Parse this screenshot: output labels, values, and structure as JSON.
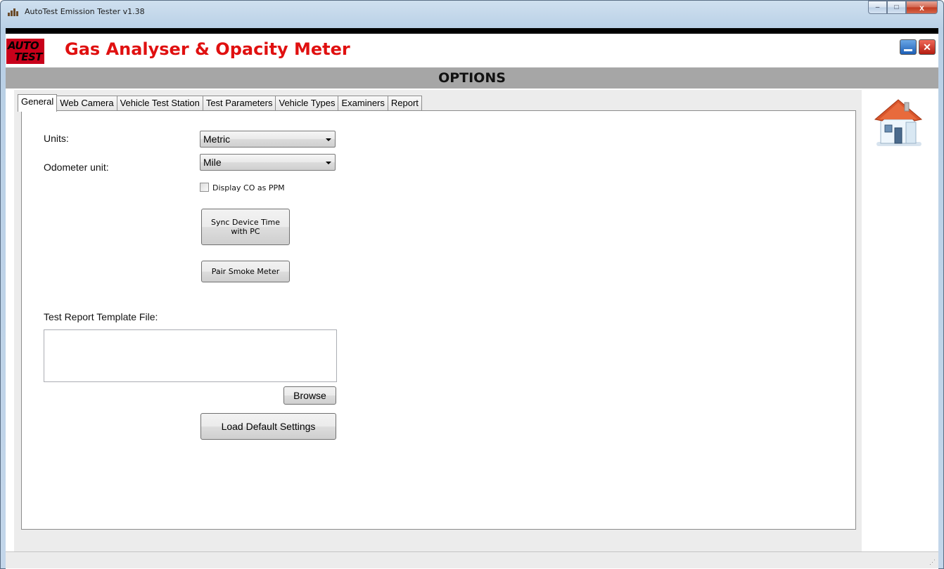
{
  "window": {
    "title": "AutoTest Emission Tester v1.38",
    "controls": {
      "minimize": "–",
      "maximize": "□",
      "close": "x"
    }
  },
  "header": {
    "logo_line1": "AUTO",
    "logo_line2": "TEST",
    "app_title": "Gas Analyser & Opacity Meter",
    "minimize_label": "",
    "close_label": "✕",
    "accent_color": "#e01010"
  },
  "options_title": "OPTIONS",
  "tabs": [
    {
      "label": "General",
      "active": true
    },
    {
      "label": "Web Camera",
      "active": false
    },
    {
      "label": "Vehicle Test Station",
      "active": false
    },
    {
      "label": "Test Parameters",
      "active": false
    },
    {
      "label": "Vehicle Types",
      "active": false
    },
    {
      "label": "Examiners",
      "active": false
    },
    {
      "label": "Report",
      "active": false
    }
  ],
  "general": {
    "units_label": "Units:",
    "units_value": "Metric",
    "odometer_label": "Odometer unit:",
    "odometer_value": "Mile",
    "display_co_label": "Display CO as PPM",
    "display_co_checked": false,
    "sync_button": "Sync Device Time with PC",
    "pair_button": "Pair Smoke Meter",
    "template_label": "Test Report Template File:",
    "template_value": "",
    "browse_button": "Browse",
    "load_defaults_button": "Load Default Settings"
  },
  "icons": {
    "home": "home-icon",
    "app": "app-icon"
  }
}
